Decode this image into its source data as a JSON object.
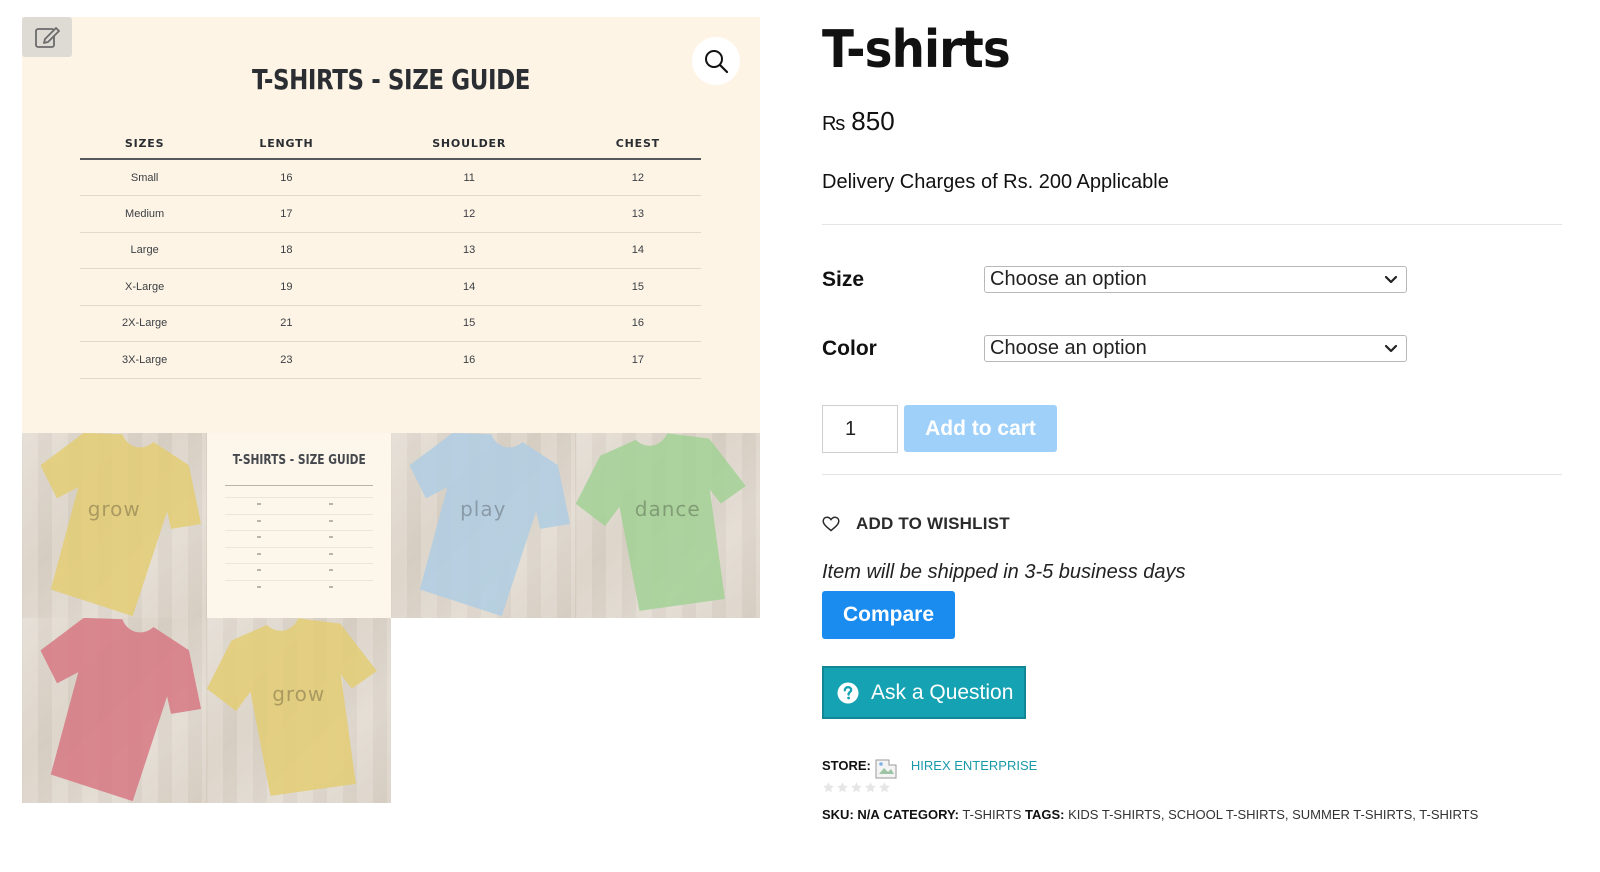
{
  "gallery": {
    "size_guide": {
      "title": "T-SHIRTS - SIZE GUIDE",
      "columns": [
        "SIZES",
        "LENGTH",
        "SHOULDER",
        "CHEST"
      ],
      "rows": [
        [
          "Small",
          "16",
          "11",
          "12"
        ],
        [
          "Medium",
          "17",
          "12",
          "13"
        ],
        [
          "Large",
          "18",
          "13",
          "14"
        ],
        [
          "X-Large",
          "19",
          "14",
          "15"
        ],
        [
          "2X-Large",
          "21",
          "15",
          "16"
        ],
        [
          "3X-Large",
          "23",
          "16",
          "17"
        ]
      ]
    },
    "thumbnails": [
      {
        "kind": "photo",
        "color": "#d9b93a",
        "word": "grow"
      },
      {
        "kind": "guide",
        "title": "T-SHIRTS - SIZE GUIDE"
      },
      {
        "kind": "photo",
        "color": "#8fb9d9",
        "word": "play"
      },
      {
        "kind": "photo",
        "color": "#7dbf6a",
        "word": "dance"
      },
      {
        "kind": "photo",
        "color": "#c8404f",
        "word": ""
      },
      {
        "kind": "photo",
        "color": "#d9b93a",
        "word": "grow"
      }
    ]
  },
  "product": {
    "title": "T-shirts",
    "currency": "₨",
    "price": "850",
    "delivery_note": "Delivery Charges of Rs. 200 Applicable",
    "variations": [
      {
        "label": "Size",
        "selected": "Choose an option"
      },
      {
        "label": "Color",
        "selected": "Choose an option"
      }
    ],
    "quantity": "1",
    "add_to_cart_label": "Add to cart",
    "wishlist_label": "ADD TO WISHLIST",
    "shipping_note": "Item will be shipped in 3-5 business days",
    "compare_label": "Compare",
    "ask_label": "Ask a Question",
    "store_label": "STORE:",
    "store_name": "HIREX ENTERPRISE",
    "meta": {
      "sku_label": "SKU:",
      "sku_value": "N/A",
      "category_label": "CATEGORY:",
      "category_value": "T-SHIRTS",
      "tags_label": "TAGS:",
      "tags": [
        "KIDS T-SHIRTS",
        "SCHOOL T-SHIRTS",
        "SUMMER T-SHIRTS",
        "T-SHIRTS"
      ]
    }
  },
  "colors": {
    "add_to_cart_bg": "#9fd0f9",
    "compare_bg": "#1a8cf0",
    "ask_bg": "#15a3b3",
    "store_link": "#1a9aa8"
  },
  "icons": [
    "edit-icon",
    "zoom-search-icon",
    "chevron-down-icon",
    "heart-icon",
    "question-circle-icon",
    "star-icon",
    "broken-image-icon"
  ]
}
